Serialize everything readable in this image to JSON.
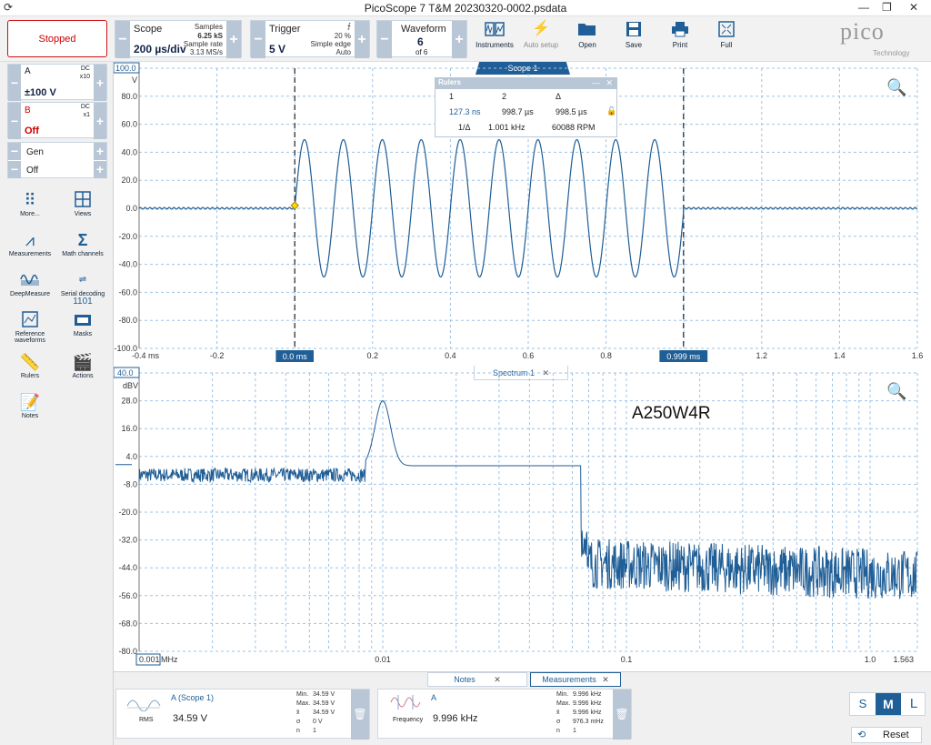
{
  "window": {
    "title": "PicoScope 7 T&M 20230320-0002.psdata"
  },
  "toolbar": {
    "run_state": "Stopped",
    "scope": {
      "label": "Scope",
      "value": "200 µs/div",
      "samples_label": "Samples",
      "samples": "6.25 kS",
      "rate_label": "Sample rate",
      "rate": "3.13 MS/s"
    },
    "trigger": {
      "label": "Trigger",
      "value": "5 V",
      "percent": "20 %",
      "type": "Simple edge",
      "mode": "Auto"
    },
    "waveform": {
      "label": "Waveform",
      "value": "6",
      "of": "of 6"
    },
    "buttons": [
      "Instruments",
      "Auto setup",
      "Open",
      "Save",
      "Print",
      "Full"
    ],
    "logo": {
      "brand": "pico",
      "sub": "Technology"
    }
  },
  "channels": [
    {
      "name": "A",
      "coupling": "DC",
      "probe": "x10",
      "range": "±100 V"
    },
    {
      "name": "B",
      "coupling": "DC",
      "probe": "x1",
      "range": "Off"
    },
    {
      "name": "Gen",
      "range": "Off"
    }
  ],
  "side_tools": [
    "More...",
    "Views",
    "Measurements",
    "Math channels",
    "DeepMeasure",
    "Serial decoding",
    "Reference waveforms",
    "Masks",
    "Rulers",
    "Actions",
    "Notes"
  ],
  "scope_view": {
    "tab": "Scope 1",
    "y_top_label": "100.0",
    "y_unit": "V",
    "y_ticks": [
      "80.0",
      "60.0",
      "40.0",
      "20.0",
      "0.0",
      "-20.0",
      "-40.0",
      "-60.0",
      "-80.0",
      "-100.0"
    ],
    "x_ticks": [
      "-0.4 ms",
      "-0.2",
      "0.0 ms",
      "0.2",
      "0.4",
      "0.6",
      "0.8",
      "0.999 ms",
      "1.2",
      "1.4",
      "1.6"
    ],
    "ruler1_label": "0.0 ms",
    "ruler2_label": "0.999 ms",
    "chart_data": {
      "type": "line",
      "x_unit": "ms",
      "ylim": [
        -100,
        100
      ],
      "xlim": [
        -0.4,
        1.6
      ],
      "series": [
        {
          "name": "A",
          "description_points": {
            "x": [
              -0.4,
              0.0,
              0.999,
              1.6
            ],
            "burst_frequency_khz": 10,
            "amplitude_v": 49,
            "burst_start_ms": 0.0,
            "burst_end_ms": 0.999
          }
        }
      ]
    }
  },
  "rulers_panel": {
    "title": "Rulers",
    "h1": "1",
    "h2": "2",
    "hd": "Δ",
    "v1": "127.3 ns",
    "v2": "998.7 µs",
    "vd": "998.5 µs",
    "inv_label": "1/Δ",
    "freq": "1.001 kHz",
    "rpm": "60088 RPM"
  },
  "spectrum_view": {
    "tab": "Spectrum 1",
    "y_top_label": "40.0",
    "y_unit": "dBV",
    "y_ticks": [
      "28.0",
      "16.0",
      "4.0",
      "-8.0",
      "-20.0",
      "-32.0",
      "-44.0",
      "-56.0",
      "-68.0",
      "-80.0"
    ],
    "x_start_label": "0.001",
    "x_unit": "MHz",
    "x_ticks": [
      "0.01",
      "0.1",
      "1.0",
      "1.563"
    ],
    "annotation": "A250W4R",
    "chart_data": {
      "type": "line",
      "x_scale": "log",
      "xlim": [
        0.001,
        1.563
      ],
      "ylim": [
        -80,
        40
      ],
      "series": [
        {
          "name": "A",
          "peak_mhz": 0.01,
          "peak_dbv": 28
        }
      ]
    }
  },
  "bottom": {
    "tabs": [
      "Notes",
      "Measurements"
    ],
    "meas": [
      {
        "title": "A (Scope 1)",
        "kind": "RMS",
        "value": "34.59 V",
        "min_l": "Min.",
        "min": "34.59 V",
        "max_l": "Max.",
        "max": "34.59 V",
        "avg_l": "x̄",
        "avg": "34.59 V",
        "sd_l": "σ",
        "sd": "0 V",
        "n_l": "n",
        "n": "1"
      },
      {
        "title": "A",
        "kind": "Frequency",
        "value": "9.996 kHz",
        "min_l": "Min.",
        "min": "9.996 kHz",
        "max_l": "Max.",
        "max": "9.996 kHz",
        "avg_l": "x̄",
        "avg": "9.996 kHz",
        "sd_l": "σ",
        "sd": "976.3 mHz",
        "n_l": "n",
        "n": "1"
      }
    ],
    "size_buttons": [
      "S",
      "M",
      "L"
    ],
    "reset": "Reset"
  },
  "colors": {
    "accent": "#1f5e96",
    "trace": "#1f5e96",
    "stopped": "#cc0000"
  }
}
